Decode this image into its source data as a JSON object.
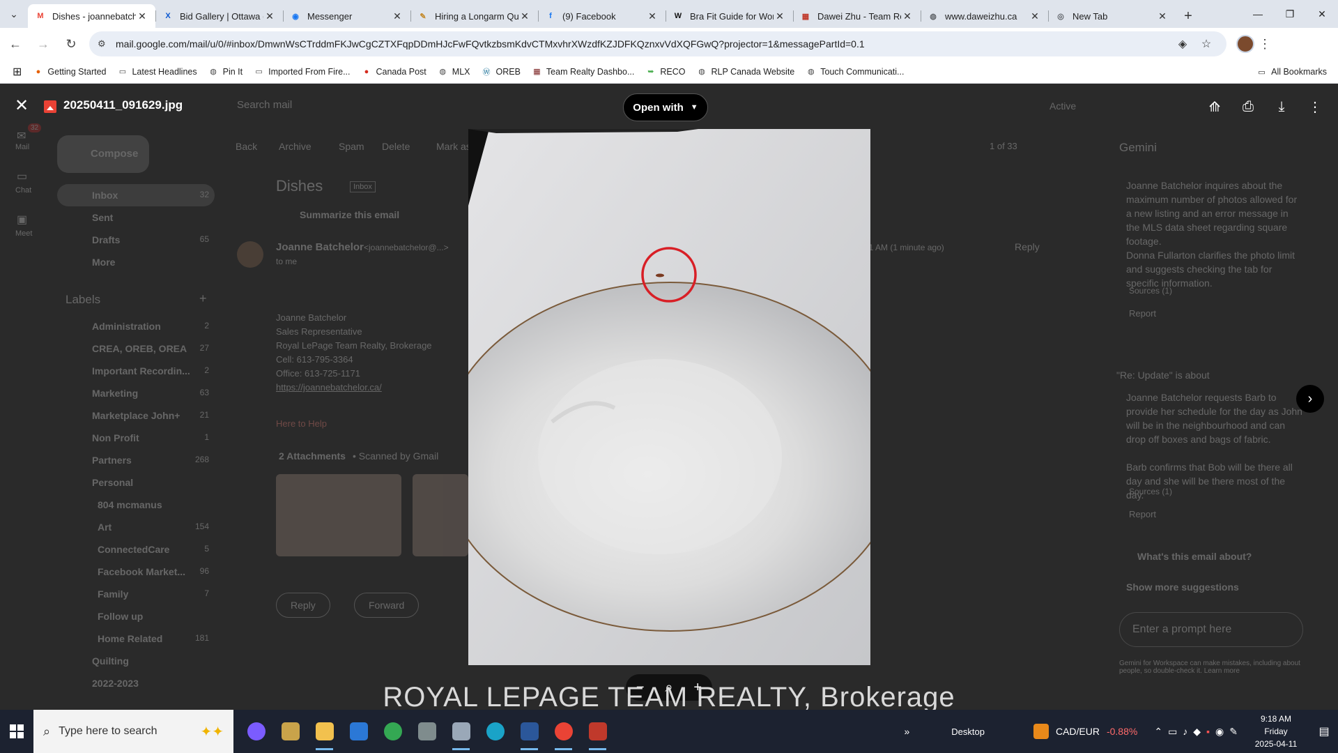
{
  "browser": {
    "tabs": [
      {
        "title": "Dishes - joannebatch",
        "icon": "gmail-icon",
        "fav": "M",
        "fav_color": "#ea4335",
        "active": true
      },
      {
        "title": "Bid Gallery | Ottawa (",
        "icon": "bidgallery-icon",
        "fav": "X",
        "fav_color": "#0b57d0",
        "active": false
      },
      {
        "title": "Messenger",
        "icon": "messenger-icon",
        "fav": "◉",
        "fav_color": "#1877f2",
        "active": false
      },
      {
        "title": "Hiring a Longarm Qu",
        "icon": "quilting-icon",
        "fav": "✎",
        "fav_color": "#c48a2c",
        "active": false
      },
      {
        "title": "(9) Facebook",
        "icon": "facebook-icon",
        "fav": "f",
        "fav_color": "#1877f2",
        "active": false
      },
      {
        "title": "Bra Fit Guide for Wor",
        "icon": "wordpress-icon",
        "fav": "W",
        "fav_color": "#111111",
        "active": false
      },
      {
        "title": "Dawei Zhu - Team Re",
        "icon": "teamrealty-icon",
        "fav": "▦",
        "fav_color": "#c0392b",
        "active": false
      },
      {
        "title": "www.daweizhu.ca",
        "icon": "globe-icon",
        "fav": "◍",
        "fav_color": "#5f6368",
        "active": false
      },
      {
        "title": "New Tab",
        "icon": "chrome-icon",
        "fav": "◎",
        "fav_color": "#5f6368",
        "active": false
      }
    ],
    "url": "mail.google.com/mail/u/0/#inbox/DmwnWsCTrddmFKJwCgCZTXFqpDDmHJcFwFQvtkzbsmKdvCTMxvhrXWzdfKZJDFKQznxvVdXQFGwQ?projector=1&messagePartId=0.1",
    "bookmarks": [
      {
        "label": "Getting Started",
        "icon": "firefox-icon",
        "glyph": "●",
        "color": "#e66000"
      },
      {
        "label": "Latest Headlines",
        "icon": "folder-icon",
        "glyph": "▭",
        "color": "#444"
      },
      {
        "label": "Pin It",
        "icon": "globe-icon",
        "glyph": "◍",
        "color": "#444"
      },
      {
        "label": "Imported From Fire...",
        "icon": "folder-icon",
        "glyph": "▭",
        "color": "#444"
      },
      {
        "label": "Canada Post",
        "icon": "canadapost-icon",
        "glyph": "●",
        "color": "#d52b1e"
      },
      {
        "label": "MLX",
        "icon": "globe-icon",
        "glyph": "◍",
        "color": "#444"
      },
      {
        "label": "OREB",
        "icon": "wordpress-icon",
        "glyph": "Ⓦ",
        "color": "#21759b"
      },
      {
        "label": "Team Realty Dashbo...",
        "icon": "teamrealty-icon",
        "glyph": "▦",
        "color": "#7a2020"
      },
      {
        "label": "RECO",
        "icon": "reco-icon",
        "glyph": "➥",
        "color": "#4caf50"
      },
      {
        "label": "RLP Canada Website",
        "icon": "globe-icon",
        "glyph": "◍",
        "color": "#444"
      },
      {
        "label": "Touch Communicati...",
        "icon": "globe-icon",
        "glyph": "◍",
        "color": "#444"
      }
    ],
    "all_bookmarks": "All Bookmarks"
  },
  "viewer": {
    "file_name": "20250411_091629.jpg",
    "open_with": "Open with",
    "watermark": "ROYAL LEPAGE TEAM REALTY, Brokerage"
  },
  "gmail_background": {
    "search_placeholder": "Search mail",
    "compose": "Compose",
    "status": "Active",
    "nav_rail": [
      {
        "label": "Mail",
        "badge": "32"
      },
      {
        "label": "Chat",
        "badge": ""
      },
      {
        "label": "Meet",
        "badge": ""
      }
    ],
    "folders": [
      {
        "label": "Inbox",
        "count": "32"
      },
      {
        "label": "Sent",
        "count": ""
      },
      {
        "label": "Drafts",
        "count": "65"
      },
      {
        "label": "More",
        "count": ""
      }
    ],
    "labels_heading": "Labels",
    "labels": [
      {
        "label": "Administration",
        "count": "2"
      },
      {
        "label": "CREA, OREB, OREA",
        "count": "27"
      },
      {
        "label": "Important Recordin...",
        "count": "2"
      },
      {
        "label": "Marketing",
        "count": "63"
      },
      {
        "label": "Marketplace John+",
        "count": "21"
      },
      {
        "label": "Non Profit",
        "count": "1"
      },
      {
        "label": "Partners",
        "count": "268"
      },
      {
        "label": "Personal",
        "count": ""
      },
      {
        "label": "804 mcmanus",
        "count": ""
      },
      {
        "label": "Art",
        "count": "154"
      },
      {
        "label": "ConnectedCare",
        "count": "5"
      },
      {
        "label": "Facebook Market...",
        "count": "96"
      },
      {
        "label": "Family",
        "count": "7"
      },
      {
        "label": "Follow up",
        "count": ""
      },
      {
        "label": "Home Related",
        "count": "181"
      },
      {
        "label": "Quilting",
        "count": ""
      },
      {
        "label": "2022-2023",
        "count": ""
      }
    ],
    "toolbar_actions": [
      "Back",
      "Archive",
      "Spam",
      "Delete",
      "Mark as unread"
    ],
    "pagination": "1 of 33",
    "subject": "Dishes",
    "inbox_tag": "Inbox",
    "summarize": "Summarize this email",
    "sender": "Joanne Batchelor",
    "sender_email": "<joannebatchelor@...>",
    "to": "to me",
    "time": "9:21 AM (1 minute ago)",
    "reply": "Reply",
    "signature": [
      "Joanne Batchelor",
      "Sales Representative",
      "Royal LePage Team Realty, Brokerage",
      "Cell:    613-795-3364",
      "Office:  613-725-1171",
      "https://joannebatchelor.ca/"
    ],
    "here_to_help": "Here to Help",
    "attachments": "2 Attachments",
    "scanned": "• Scanned by Gmail",
    "reply_button": "Reply",
    "forward_button": "Forward",
    "gemini_title": "Gemini",
    "gemini_bullets_1": [
      "Joanne Batchelor inquires about the maximum number of photos allowed for a new listing and an error message in the MLS data sheet regarding square footage.",
      "Donna Fullarton clarifies the photo limit and suggests checking the tab for specific information."
    ],
    "sources_1": "Sources (1)",
    "report": "Report",
    "gemini_about": "\"Re: Update\" is about",
    "gemini_bullets_2": [
      "Joanne Batchelor requests Barb to provide her schedule for the day as John will be in the neighbourhood and can drop off boxes and bags of fabric.",
      "Barb confirms that Bob will be there all day and she will be there most of the day."
    ],
    "sources_2": "Sources (1)",
    "suggestion": "What's this email about?",
    "show_more": "Show more suggestions",
    "prompt_placeholder": "Enter a prompt here",
    "disclaimer": "Gemini for Workspace can make mistakes, including about people, so double-check it. Learn more"
  },
  "taskbar": {
    "search_placeholder": "Type here to search",
    "apps": [
      {
        "name": "copilot-icon",
        "color": "#7b5cff",
        "running": false
      },
      {
        "name": "file-explorer-icon",
        "color": "#c9a34a",
        "running": false
      },
      {
        "name": "folder-icon",
        "color": "#f2c14e",
        "running": true
      },
      {
        "name": "store-icon",
        "color": "#2b78d6",
        "running": false
      },
      {
        "name": "chrome-icon",
        "color": "#34a853",
        "running": false
      },
      {
        "name": "app-icon",
        "color": "#7f8c8d",
        "running": false
      },
      {
        "name": "app-icon",
        "color": "#9aa8b8",
        "running": true
      },
      {
        "name": "edge-icon",
        "color": "#1aa3c8",
        "running": false
      },
      {
        "name": "word-icon",
        "color": "#2b579a",
        "running": true
      },
      {
        "name": "chrome-icon",
        "color": "#ea4335",
        "running": true
      },
      {
        "name": "pdf-icon",
        "color": "#c0392b",
        "running": true
      }
    ],
    "desktop_label": "Desktop",
    "currency": "CAD/EUR",
    "currency_change": "-0.88%",
    "time": "9:18 AM",
    "day": "Friday",
    "date": "2025-04-11"
  },
  "colors": {
    "accent_red": "#e53935",
    "chrome_tabstrip": "#dfe4ec",
    "viewer_backdrop": "#2a2a2a"
  }
}
